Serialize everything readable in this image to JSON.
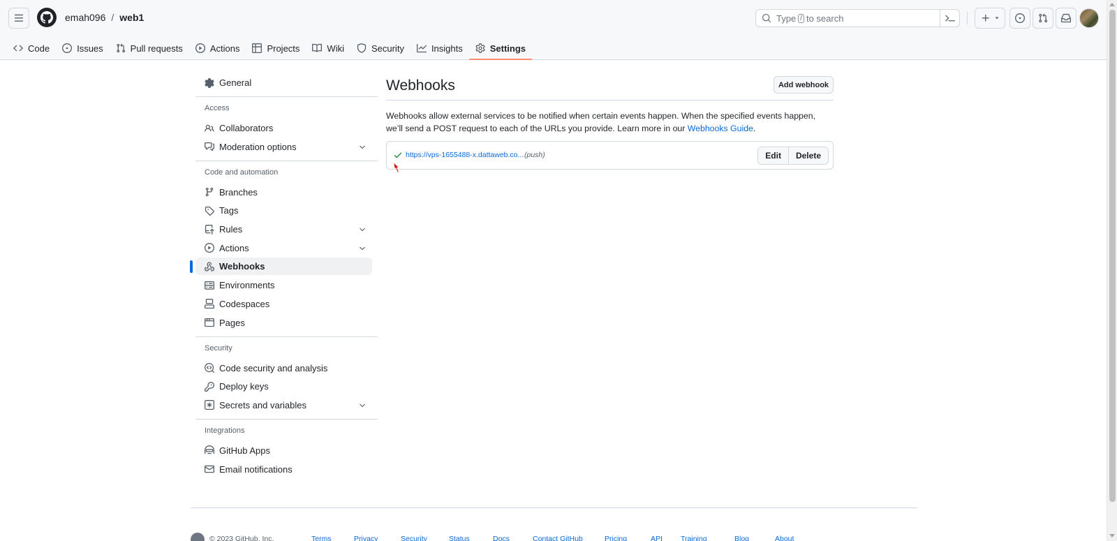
{
  "header": {
    "owner": "emah096",
    "separator": "/",
    "repo": "web1",
    "search_placeholder_pre": "Type",
    "search_key": "/",
    "search_placeholder_post": "to search"
  },
  "tabs": [
    {
      "label": "Code",
      "icon": "code-icon"
    },
    {
      "label": "Issues",
      "icon": "issue-opened-icon"
    },
    {
      "label": "Pull requests",
      "icon": "git-pull-request-icon"
    },
    {
      "label": "Actions",
      "icon": "play-icon"
    },
    {
      "label": "Projects",
      "icon": "table-icon"
    },
    {
      "label": "Wiki",
      "icon": "book-icon"
    },
    {
      "label": "Security",
      "icon": "shield-icon"
    },
    {
      "label": "Insights",
      "icon": "graph-icon"
    },
    {
      "label": "Settings",
      "icon": "gear-icon",
      "active": true
    }
  ],
  "sidebar": {
    "general": "General",
    "access_head": "Access",
    "collaborators": "Collaborators",
    "moderation": "Moderation options",
    "code_head": "Code and automation",
    "branches": "Branches",
    "tags": "Tags",
    "rules": "Rules",
    "actions": "Actions",
    "webhooks": "Webhooks",
    "environments": "Environments",
    "codespaces": "Codespaces",
    "pages": "Pages",
    "security_head": "Security",
    "code_security": "Code security and analysis",
    "deploy_keys": "Deploy keys",
    "secrets": "Secrets and variables",
    "integrations_head": "Integrations",
    "github_apps": "GitHub Apps",
    "email_notifications": "Email notifications"
  },
  "main": {
    "title": "Webhooks",
    "add_button": "Add webhook",
    "description": "Webhooks allow external services to be notified when certain events happen. When the specified events happen, we’ll send a POST request to each of the URLs you provide. Learn more in our ",
    "guide_link": "Webhooks Guide",
    "description_end": ".",
    "hook_url": "https://vps-1655488-x.dattaweb.co...",
    "hook_events": "(push)",
    "edit_button": "Edit",
    "delete_button": "Delete"
  },
  "footer": {
    "copyright": "© 2023 GitHub, Inc.",
    "links": [
      "Terms",
      "Privacy",
      "Security",
      "Status",
      "Docs",
      "Contact GitHub",
      "Pricing",
      "API",
      "Training",
      "Blog",
      "About"
    ]
  },
  "colors": {
    "accent": "#0969da",
    "tab_underline": "#fd8c73",
    "success": "#1a7f37"
  }
}
